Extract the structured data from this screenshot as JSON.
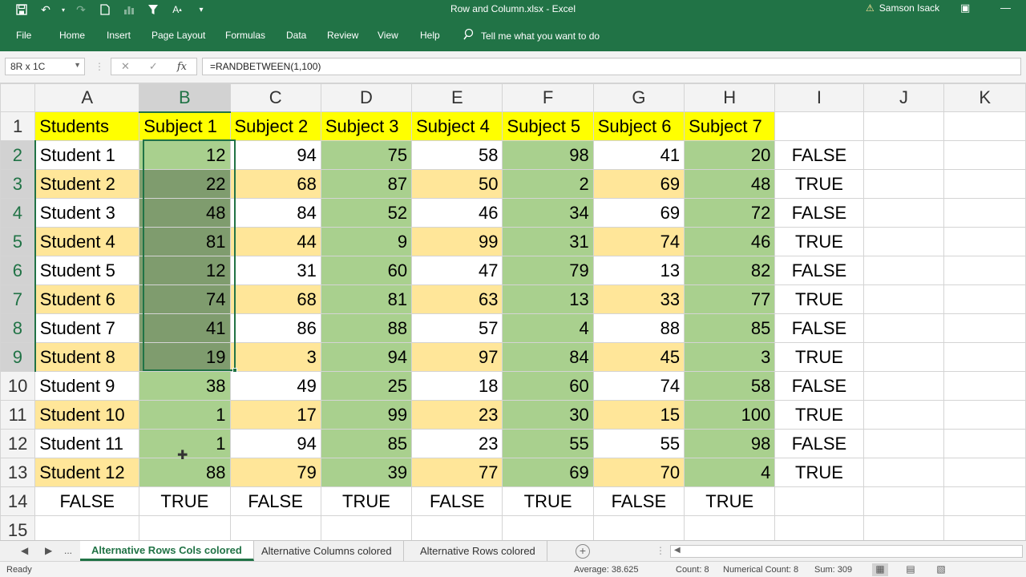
{
  "titlebar": {
    "title": "Row and Column.xlsx  -  Excel",
    "user": "Samson Isack",
    "icons": [
      "save-icon",
      "undo-icon",
      "redo-icon",
      "new-icon",
      "chart-icon",
      "filter-icon",
      "font-size-icon",
      "customize-icon"
    ]
  },
  "menu": {
    "items": [
      "File",
      "Home",
      "Insert",
      "Page Layout",
      "Formulas",
      "Data",
      "Review",
      "View",
      "Help"
    ],
    "tell_me": "Tell me what you want to do"
  },
  "formula_bar": {
    "name_box": "8R x 1C",
    "fx": "fx",
    "formula": "=RANDBETWEEN(1,100)"
  },
  "columns": [
    "A",
    "B",
    "C",
    "D",
    "E",
    "F",
    "G",
    "H",
    "I",
    "J",
    "K"
  ],
  "header_row": [
    "Students",
    "Subject 1",
    "Subject 2",
    "Subject 3",
    "Subject 4",
    "Subject 5",
    "Subject 6",
    "Subject 7"
  ],
  "rows": [
    {
      "name": "Student 1",
      "scores": [
        "12",
        "94",
        "75",
        "58",
        "98",
        "41",
        "20"
      ],
      "flag": "FALSE"
    },
    {
      "name": "Student 2",
      "scores": [
        "22",
        "68",
        "87",
        "50",
        "2",
        "69",
        "48"
      ],
      "flag": "TRUE"
    },
    {
      "name": "Student 3",
      "scores": [
        "48",
        "84",
        "52",
        "46",
        "34",
        "69",
        "72"
      ],
      "flag": "FALSE"
    },
    {
      "name": "Student 4",
      "scores": [
        "81",
        "44",
        "9",
        "99",
        "31",
        "74",
        "46"
      ],
      "flag": "TRUE"
    },
    {
      "name": "Student 5",
      "scores": [
        "12",
        "31",
        "60",
        "47",
        "79",
        "13",
        "82"
      ],
      "flag": "FALSE"
    },
    {
      "name": "Student 6",
      "scores": [
        "74",
        "68",
        "81",
        "63",
        "13",
        "33",
        "77"
      ],
      "flag": "TRUE"
    },
    {
      "name": "Student 7",
      "scores": [
        "41",
        "86",
        "88",
        "57",
        "4",
        "88",
        "85"
      ],
      "flag": "FALSE"
    },
    {
      "name": "Student 8",
      "scores": [
        "19",
        "3",
        "94",
        "97",
        "84",
        "45",
        "3"
      ],
      "flag": "TRUE"
    },
    {
      "name": "Student 9",
      "scores": [
        "38",
        "49",
        "25",
        "18",
        "60",
        "74",
        "58"
      ],
      "flag": "FALSE"
    },
    {
      "name": "Student 10",
      "scores": [
        "1",
        "17",
        "99",
        "23",
        "30",
        "15",
        "100"
      ],
      "flag": "TRUE"
    },
    {
      "name": "Student 11",
      "scores": [
        "1",
        "94",
        "85",
        "23",
        "55",
        "55",
        "98"
      ],
      "flag": "FALSE"
    },
    {
      "name": "Student 12",
      "scores": [
        "88",
        "79",
        "39",
        "77",
        "69",
        "70",
        "4"
      ],
      "flag": "TRUE"
    }
  ],
  "row14": [
    "FALSE",
    "TRUE",
    "FALSE",
    "TRUE",
    "FALSE",
    "TRUE",
    "FALSE",
    "TRUE"
  ],
  "colors": {
    "header_yellow": "#ffff00",
    "green": "#a9d08e",
    "tan": "#ffe699",
    "selected_green": "#7f9c6e",
    "excel_green": "#217346"
  },
  "tabs": {
    "more": "...",
    "sheets": [
      "Alternative Rows Cols colored",
      "Alternative Columns colored",
      "Alternative Rows colored"
    ],
    "active": 0
  },
  "status": {
    "ready": "Ready",
    "average": "Average: 38.625",
    "count": "Count: 8",
    "numerical_count": "Numerical Count: 8",
    "sum": "Sum: 309"
  }
}
